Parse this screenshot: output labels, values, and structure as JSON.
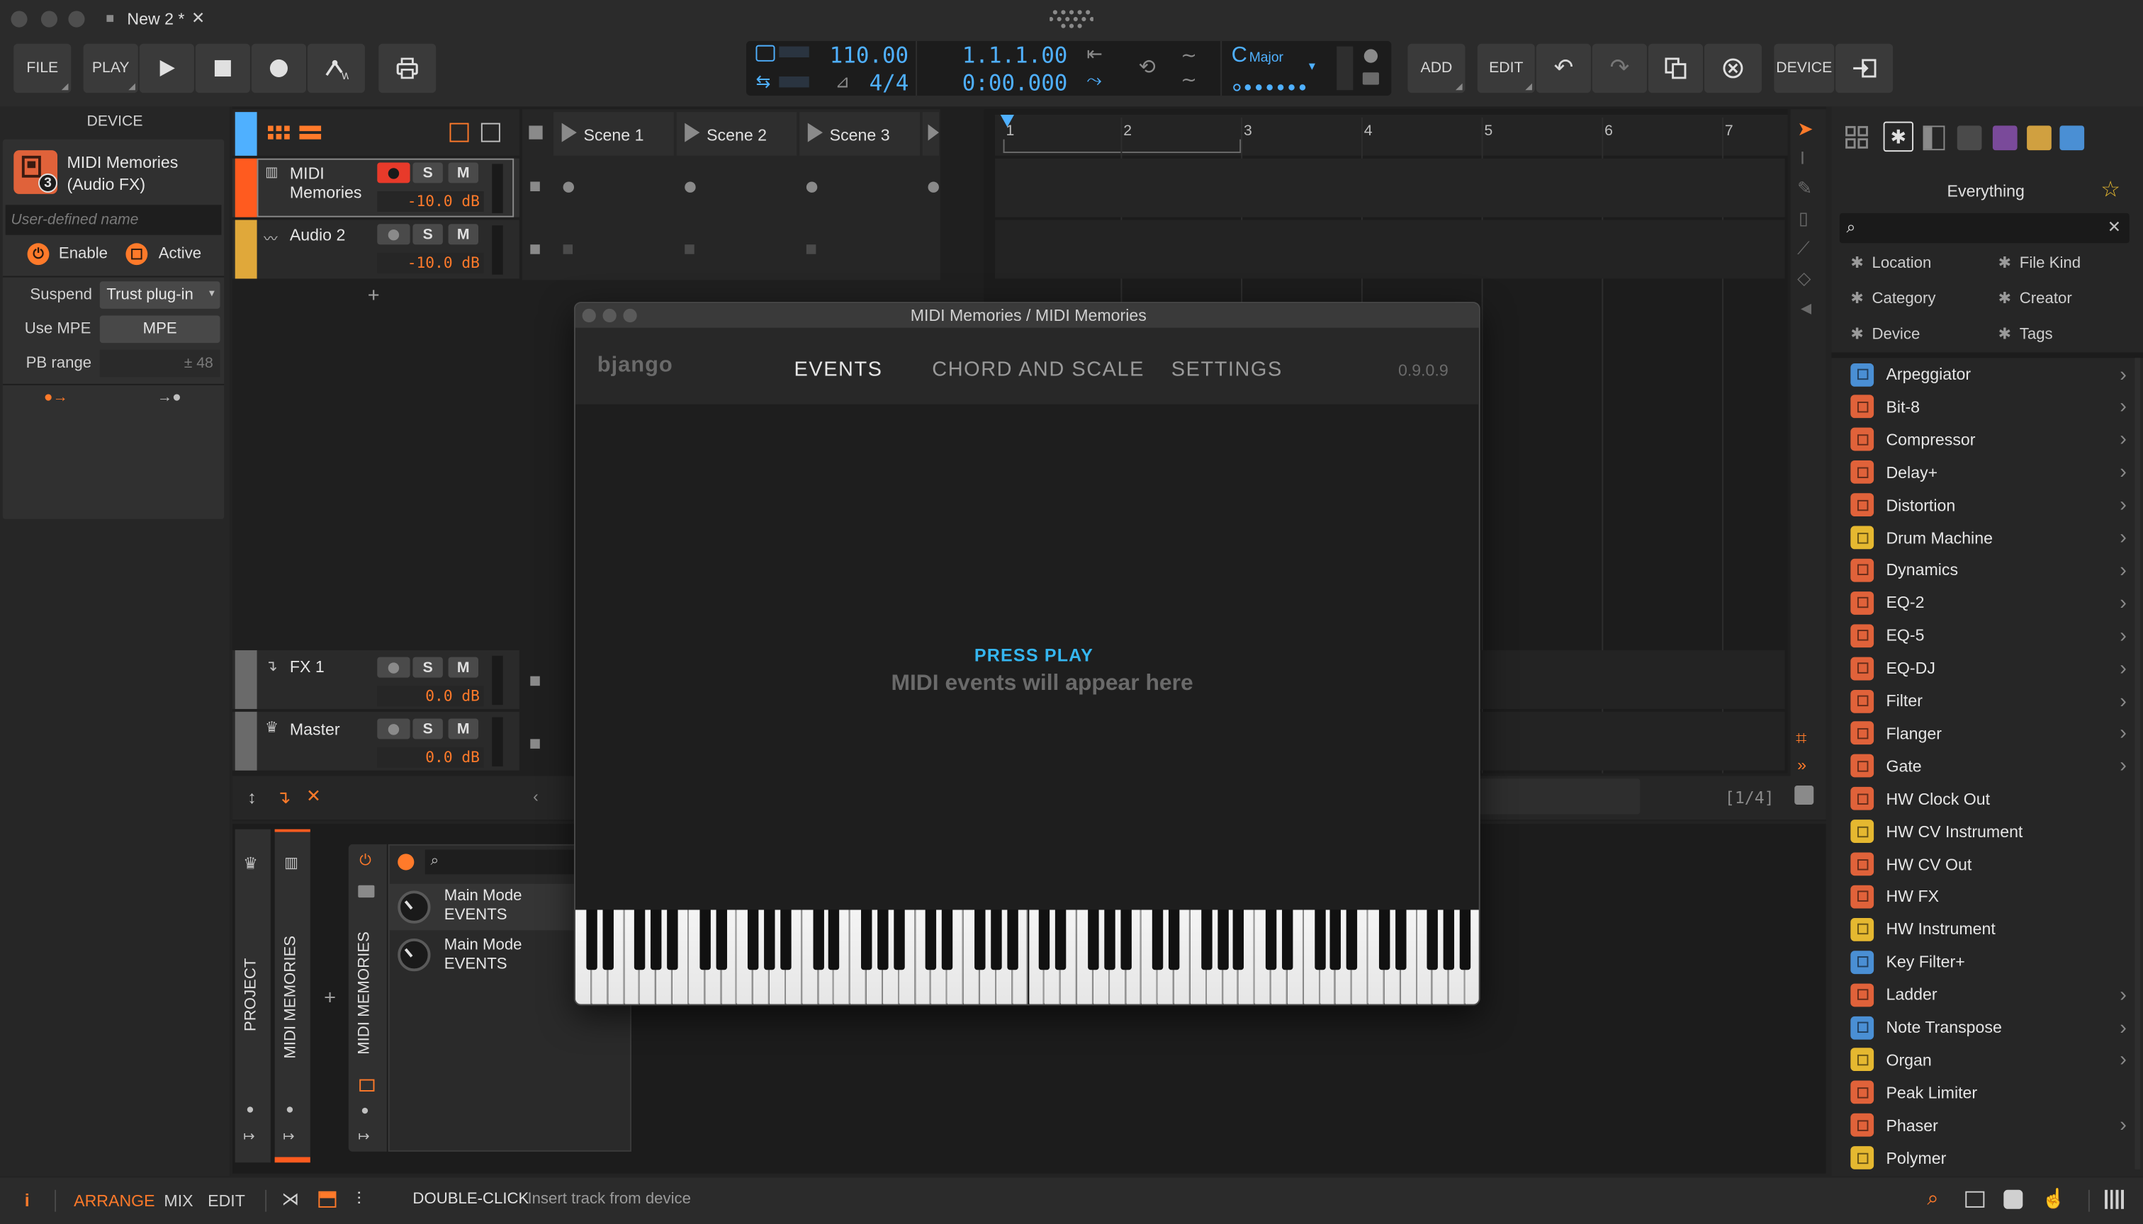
{
  "window": {
    "tab_title": "New 2 *",
    "tab_close": "✕"
  },
  "toolbar": {
    "file_label": "FILE",
    "play_label": "PLAY",
    "tempo": "110.00",
    "signature": "4/4",
    "position_bars": "1.1.1.00",
    "position_time": "0:00.000",
    "key_root": "C",
    "key_scale": "Major",
    "add_label": "ADD",
    "edit_label": "EDIT",
    "device_label": "DEVICE"
  },
  "device_panel": {
    "header": "DEVICE",
    "name_line1": "MIDI Memories",
    "name_line2": "(Audio FX)",
    "badge": "3",
    "user_name_placeholder": "User-defined name",
    "enable_label": "Enable",
    "active_label": "Active",
    "suspend_label": "Suspend",
    "suspend_value": "Trust plug-in",
    "use_mpe_label": "Use MPE",
    "use_mpe_value": "MPE",
    "pb_range_label": "PB range",
    "pb_range_value": "± 48"
  },
  "tracks": [
    {
      "name_line1": "MIDI",
      "name_line2": "Memories",
      "volume": "-10.0 dB",
      "s": "S",
      "m": "M"
    },
    {
      "name_line1": "Audio 2",
      "name_line2": "",
      "volume": "-10.0 dB",
      "s": "S",
      "m": "M"
    },
    {
      "name_line1": "FX 1",
      "name_line2": "",
      "volume": "0.0 dB",
      "s": "S",
      "m": "M"
    },
    {
      "name_line1": "Master",
      "name_line2": "",
      "volume": "0.0 dB",
      "s": "S",
      "m": "M"
    }
  ],
  "add_track": "+",
  "scenes": [
    "Scene 1",
    "Scene 2",
    "Scene 3"
  ],
  "ruler": [
    "1",
    "2",
    "3",
    "4",
    "5",
    "6",
    "7"
  ],
  "page_indicator": "[1/4]",
  "plugin": {
    "title": "MIDI Memories / MIDI Memories",
    "logo": "bjango",
    "tabs": [
      "EVENTS",
      "CHORD AND SCALE",
      "SETTINGS"
    ],
    "version": "0.9.0.9",
    "press_play": "PRESS PLAY",
    "message": "MIDI events will appear here"
  },
  "device_chain": {
    "project_label": "PROJECT",
    "track_label": "MIDI MEMORIES",
    "device_label": "MIDI MEMORIES",
    "add": "+",
    "params": [
      {
        "line1": "Main Mode",
        "line2": "EVENTS"
      },
      {
        "line1": "Main Mode",
        "line2": "EVENTS"
      }
    ]
  },
  "browser": {
    "title": "Everything",
    "filters": [
      "Location",
      "File Kind",
      "Category",
      "Creator",
      "Device",
      "Tags"
    ],
    "items": [
      {
        "label": "Arpeggiator",
        "color": "#4a8fd4",
        "chevron": true
      },
      {
        "label": "Bit-8",
        "color": "#e0623a",
        "chevron": true
      },
      {
        "label": "Compressor",
        "color": "#e0623a",
        "chevron": true
      },
      {
        "label": "Delay+",
        "color": "#e0623a",
        "chevron": true
      },
      {
        "label": "Distortion",
        "color": "#e0623a",
        "chevron": true
      },
      {
        "label": "Drum Machine",
        "color": "#e5b830",
        "chevron": true
      },
      {
        "label": "Dynamics",
        "color": "#e0623a",
        "chevron": true
      },
      {
        "label": "EQ-2",
        "color": "#e0623a",
        "chevron": true
      },
      {
        "label": "EQ-5",
        "color": "#e0623a",
        "chevron": true
      },
      {
        "label": "EQ-DJ",
        "color": "#e0623a",
        "chevron": true
      },
      {
        "label": "Filter",
        "color": "#e0623a",
        "chevron": true
      },
      {
        "label": "Flanger",
        "color": "#e0623a",
        "chevron": true
      },
      {
        "label": "Gate",
        "color": "#e0623a",
        "chevron": true
      },
      {
        "label": "HW Clock Out",
        "color": "#e0623a",
        "chevron": false
      },
      {
        "label": "HW CV Instrument",
        "color": "#e5b830",
        "chevron": false
      },
      {
        "label": "HW CV Out",
        "color": "#e0623a",
        "chevron": false
      },
      {
        "label": "HW FX",
        "color": "#e0623a",
        "chevron": false
      },
      {
        "label": "HW Instrument",
        "color": "#e5b830",
        "chevron": false
      },
      {
        "label": "Key Filter+",
        "color": "#4a8fd4",
        "chevron": false
      },
      {
        "label": "Ladder",
        "color": "#e0623a",
        "chevron": true
      },
      {
        "label": "Note Transpose",
        "color": "#4a8fd4",
        "chevron": true
      },
      {
        "label": "Organ",
        "color": "#e5b830",
        "chevron": true
      },
      {
        "label": "Peak Limiter",
        "color": "#e0623a",
        "chevron": false
      },
      {
        "label": "Phaser",
        "color": "#e0623a",
        "chevron": true
      },
      {
        "label": "Polymer",
        "color": "#e5b830",
        "chevron": false
      }
    ]
  },
  "statusbar": {
    "info": "i",
    "arrange": "ARRANGE",
    "mix": "MIX",
    "edit": "EDIT",
    "hint_key": "DOUBLE-CLICK",
    "hint_text": "Insert track from device"
  },
  "colors": {
    "accent": "#ff7a2a",
    "blue": "#4fb0ff",
    "track_midi": "#ff5b1f",
    "track_audio": "#e0a83a"
  }
}
